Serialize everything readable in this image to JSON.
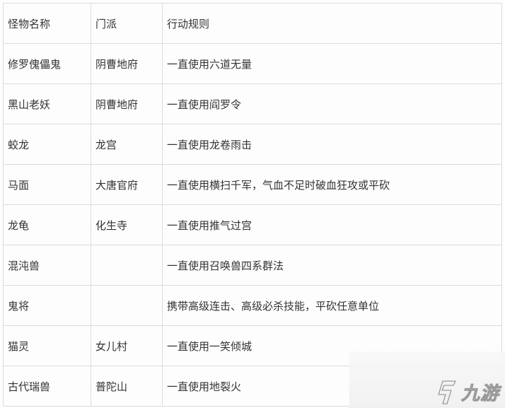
{
  "table": {
    "headers": [
      "怪物名称",
      "门派",
      "行动规则"
    ],
    "rows": [
      {
        "name": "修罗傀儡鬼",
        "sect": "阴曹地府",
        "rule": "一直使用六道无量"
      },
      {
        "name": "黑山老妖",
        "sect": "阴曹地府",
        "rule": "一直使用阎罗令"
      },
      {
        "name": "蛟龙",
        "sect": "龙宫",
        "rule": "一直使用龙卷雨击"
      },
      {
        "name": "马面",
        "sect": "大唐官府",
        "rule": "一直使用横扫千军，气血不足时破血狂攻或平砍"
      },
      {
        "name": "龙龟",
        "sect": "化生寺",
        "rule": "一直使用推气过宫"
      },
      {
        "name": "混沌兽",
        "sect": "",
        "rule": "一直使用召唤兽四系群法"
      },
      {
        "name": "鬼将",
        "sect": "",
        "rule": "携带高级连击、高级必杀技能，平砍任意单位"
      },
      {
        "name": "猫灵",
        "sect": "女儿村",
        "rule": "一直使用一笑倾城"
      },
      {
        "name": "古代瑞兽",
        "sect": "普陀山",
        "rule": "一直使用地裂火"
      }
    ]
  },
  "watermark": {
    "icon": "jiuyou-logo-icon",
    "text": "九游"
  }
}
